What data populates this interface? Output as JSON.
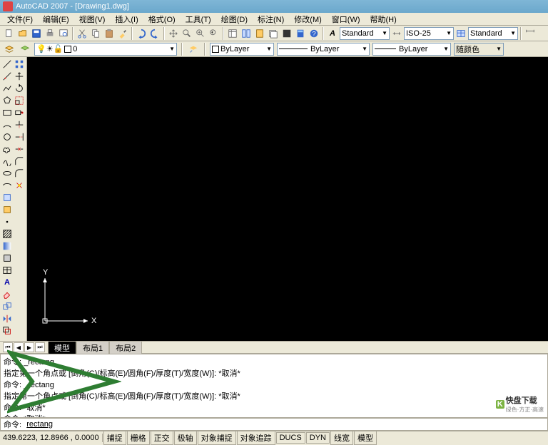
{
  "title": "AutoCAD 2007 - [Drawing1.dwg]",
  "menus": [
    "文件(F)",
    "编辑(E)",
    "视图(V)",
    "插入(I)",
    "格式(O)",
    "工具(T)",
    "绘图(D)",
    "标注(N)",
    "修改(M)",
    "窗口(W)",
    "帮助(H)"
  ],
  "style_dd": {
    "text_style": "Standard",
    "dim_style": "ISO-25",
    "table_style": "Standard"
  },
  "layer_dd": {
    "layer": "0",
    "color": "ByLayer",
    "linetype": "ByLayer",
    "lineweight": "ByLayer",
    "plotstyle": "随颜色"
  },
  "tabs": {
    "active": "模型",
    "others": [
      "布局1",
      "布局2"
    ]
  },
  "cmd_history": [
    "命令: _rectang",
    "指定第一个角点或 [倒角(C)/标高(E)/圆角(F)/厚度(T)/宽度(W)]: *取消*",
    "命令: _rectang",
    "指定第一个角点或 [倒角(C)/标高(E)/圆角(F)/厚度(T)/宽度(W)]: *取消*",
    "命令: *取消*",
    "命令: *取消*"
  ],
  "cmd_prompt": "命令:",
  "cmd_current": "rectang",
  "coords": "439.6223, 12.8966 , 0.0000",
  "status_btns": [
    "捕捉",
    "栅格",
    "正交",
    "极轴",
    "对象捕捉",
    "对象追踪",
    "DUCS",
    "DYN",
    "线宽",
    "模型"
  ],
  "ucs": {
    "x": "X",
    "y": "Y"
  },
  "watermark": {
    "brand": "快盘下载",
    "sub": "绿色·方正·高速"
  }
}
